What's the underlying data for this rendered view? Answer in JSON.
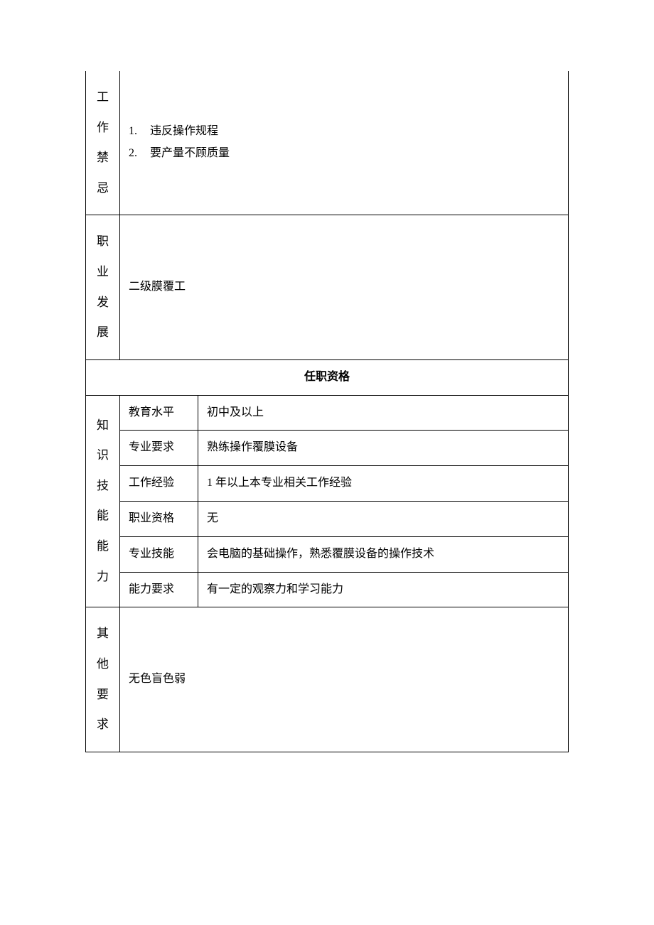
{
  "sections": {
    "work_prohibitions": {
      "label_chars": [
        "工",
        "作",
        "禁",
        "忌"
      ],
      "items": [
        {
          "num": "1.",
          "text": "违反操作规程"
        },
        {
          "num": "2.",
          "text": "要产量不顾质量"
        }
      ]
    },
    "career_development": {
      "label_chars": [
        "职",
        "业",
        "发",
        "展"
      ],
      "content": "二级膜覆工"
    },
    "qualification_header": "任职资格",
    "knowledge_skills": {
      "label_chars": [
        "知",
        "识",
        "技",
        "能",
        "能",
        "力"
      ],
      "rows": [
        {
          "label": "教育水平",
          "value": "初中及以上"
        },
        {
          "label": "专业要求",
          "value": "熟练操作覆膜设备"
        },
        {
          "label": "工作经验",
          "value": "1 年以上本专业相关工作经验"
        },
        {
          "label": "职业资格",
          "value": "无"
        },
        {
          "label": "专业技能",
          "value": "会电脑的基础操作，熟悉覆膜设备的操作技术"
        },
        {
          "label": "能力要求",
          "value": "有一定的观察力和学习能力"
        }
      ]
    },
    "other_requirements": {
      "label_chars": [
        "其",
        "他",
        "要",
        "求"
      ],
      "content": "无色盲色弱"
    }
  }
}
